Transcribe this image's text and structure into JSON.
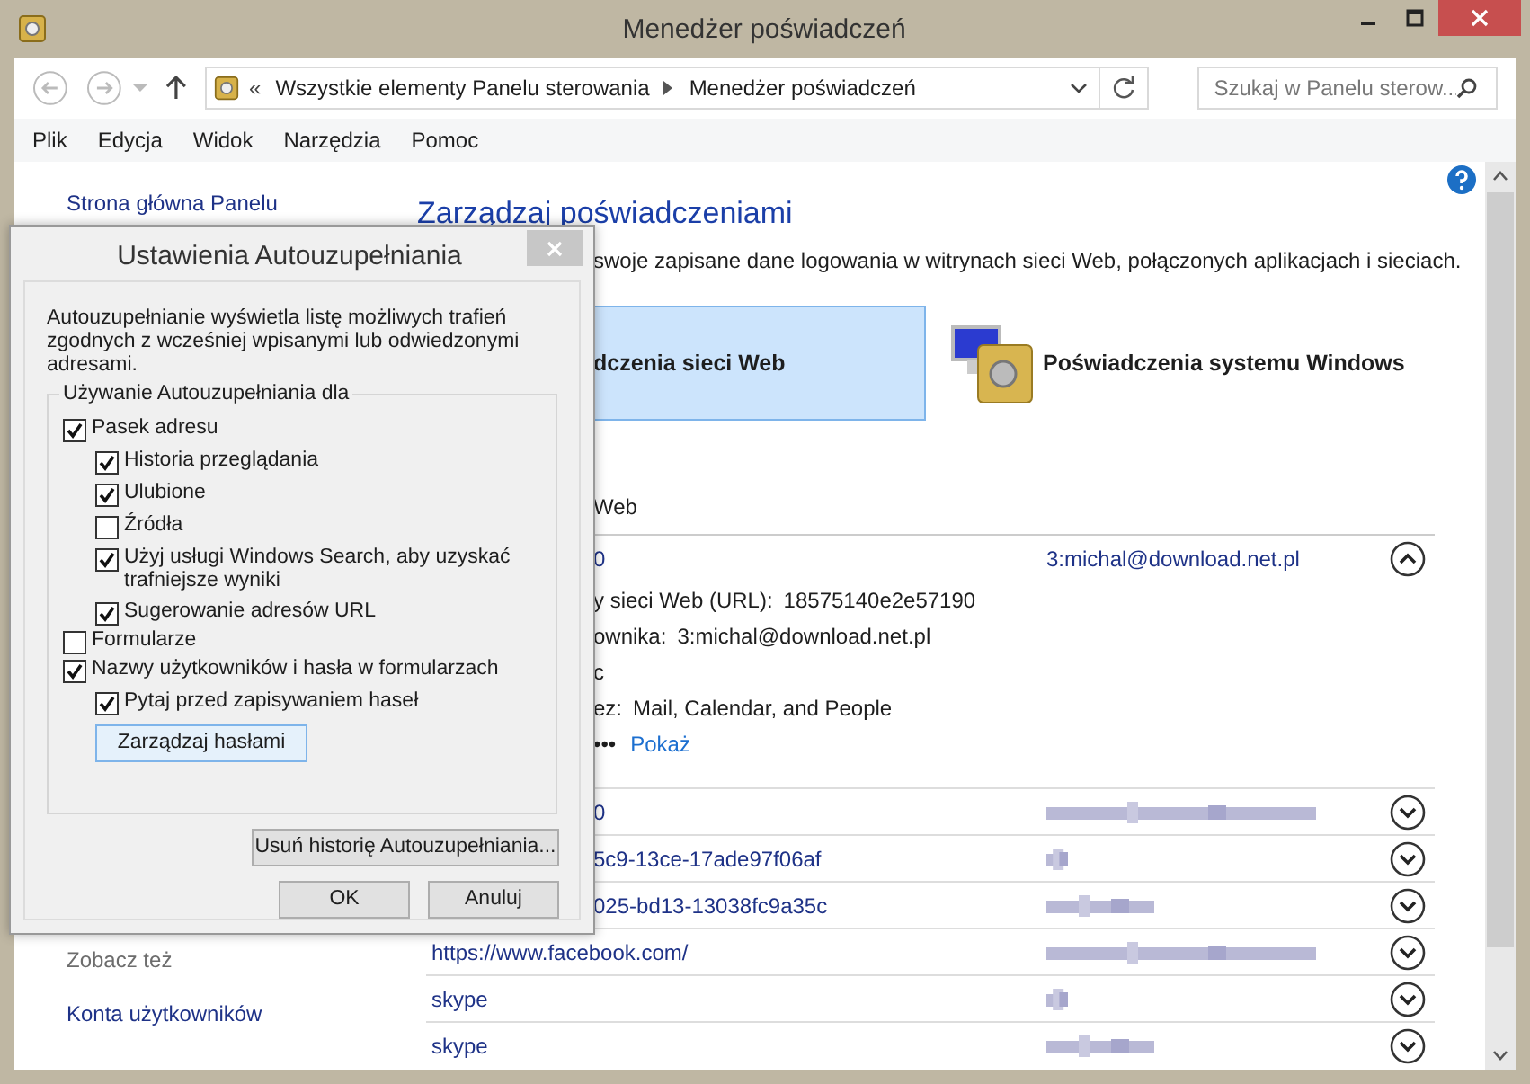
{
  "window": {
    "title": "Menedżer poświadczeń"
  },
  "address_bar": {
    "overflow": "«",
    "path": [
      "Wszystkie elementy Panelu sterowania",
      "Menedżer poświadczeń"
    ]
  },
  "search": {
    "placeholder": "Szukaj w Panelu sterow..."
  },
  "menu": [
    "Plik",
    "Edycja",
    "Widok",
    "Narzędzia",
    "Pomoc"
  ],
  "sidebar": {
    "top_link": "Strona główna Panelu",
    "see_also_heading": "Zobacz też",
    "see_also_links": [
      "Konta użytkowników"
    ]
  },
  "content": {
    "title": "Zarządzaj poświadczeniami",
    "description": "swoje zapisane dane logowania w witrynach sieci Web, połączonych aplikacjach i sieciach.",
    "tiles": [
      {
        "label": "dczenia sieci Web",
        "selected": true,
        "kind": "web"
      },
      {
        "label": "Poświadczenia systemu Windows",
        "selected": false,
        "kind": "windows"
      }
    ],
    "section_heading": "Web",
    "expanded_entry": {
      "name": "0",
      "user": "3:michal@download.net.pl",
      "expanded": true,
      "details": [
        {
          "label": "y sieci Web (URL):",
          "value": "18575140e2e57190"
        },
        {
          "label": "ownika:",
          "value": "3:michal@download.net.pl"
        },
        {
          "label": "c"
        },
        {
          "label": "ez:",
          "value": "Mail, Calendar, and People"
        }
      ],
      "password": {
        "dots": "•••",
        "link": "Pokaż"
      }
    },
    "entries": [
      {
        "name": "0",
        "kind": "cut",
        "expanded": false
      },
      {
        "name": "5c9-13ce-17ade97f06af",
        "kind": "cut",
        "expanded": false
      },
      {
        "name": "025-bd13-13038fc9a35c",
        "kind": "cut",
        "expanded": false
      },
      {
        "name": "https://www.facebook.com/",
        "kind": "full",
        "expanded": false
      },
      {
        "name": "skype",
        "kind": "full",
        "expanded": false
      },
      {
        "name": "skype",
        "kind": "full",
        "expanded": false
      }
    ]
  },
  "dialog": {
    "title": "Ustawienia Autouzupełniania",
    "description": "Autouzupełnianie wyświetla listę możliwych trafień zgodnych z wcześniej wpisanymi lub odwiedzonymi adresami.",
    "group_label": "Używanie Autouzupełniania dla",
    "options": [
      {
        "label": "Pasek adresu",
        "checked": true,
        "children": [
          {
            "label": "Historia przeglądania",
            "checked": true
          },
          {
            "label": "Ulubione",
            "checked": true
          },
          {
            "label": "Źródła",
            "checked": false
          },
          {
            "label": "Użyj usługi Windows Search, aby uzyskać trafniejsze wyniki",
            "checked": true
          },
          {
            "label": "Sugerowanie adresów URL",
            "checked": true
          }
        ]
      },
      {
        "label": "Formularze",
        "checked": false
      },
      {
        "label": "Nazwy użytkowników i hasła w formularzach",
        "checked": true,
        "children": [
          {
            "label": "Pytaj przed zapisywaniem haseł",
            "checked": true
          }
        ]
      }
    ],
    "manage_button": "Zarządzaj hasłami",
    "clear_button": "Usuń historię Autouzupełniania...",
    "ok_button": "OK",
    "cancel_button": "Anuluj"
  }
}
